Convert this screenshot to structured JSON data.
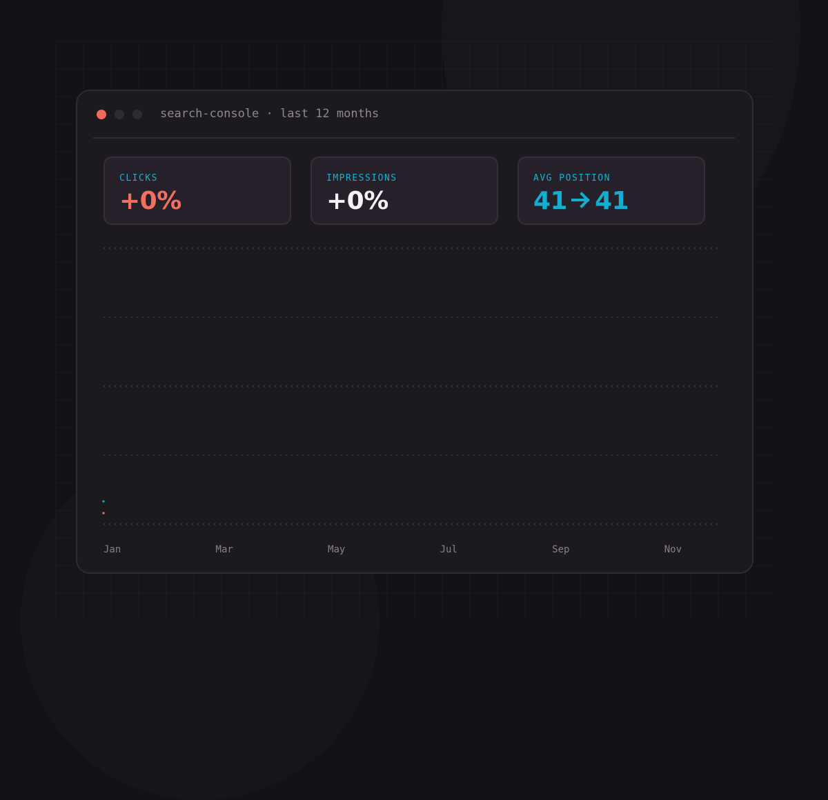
{
  "window": {
    "title": "search-console · last 12 months",
    "controls": [
      "close",
      "minimize",
      "maximize"
    ]
  },
  "stats": {
    "clicks": {
      "label": "CLICKS",
      "value": "+0%"
    },
    "impressions": {
      "label": "IMPRESSIONS",
      "value": "+0%"
    },
    "avg_position": {
      "label": "AVG POSITION",
      "from": "41",
      "to": "41"
    }
  },
  "colors": {
    "accent_coral": "#f27060",
    "accent_cyan": "#14aed0",
    "text_white": "#f4f2f5"
  },
  "chart_data": {
    "type": "line",
    "categories": [
      "Jan",
      "Mar",
      "May",
      "Jul",
      "Sep",
      "Nov"
    ],
    "x_ticks": [
      "Jan",
      "Mar",
      "May",
      "Jul",
      "Sep",
      "Nov"
    ],
    "grid": true,
    "series": [
      {
        "key": "clicks",
        "color": "#f27060",
        "values": [
          0.16
        ]
      },
      {
        "key": "impressions",
        "color": "#14aed0",
        "values": [
          0.33
        ]
      }
    ],
    "ylim": [
      0,
      4
    ]
  }
}
